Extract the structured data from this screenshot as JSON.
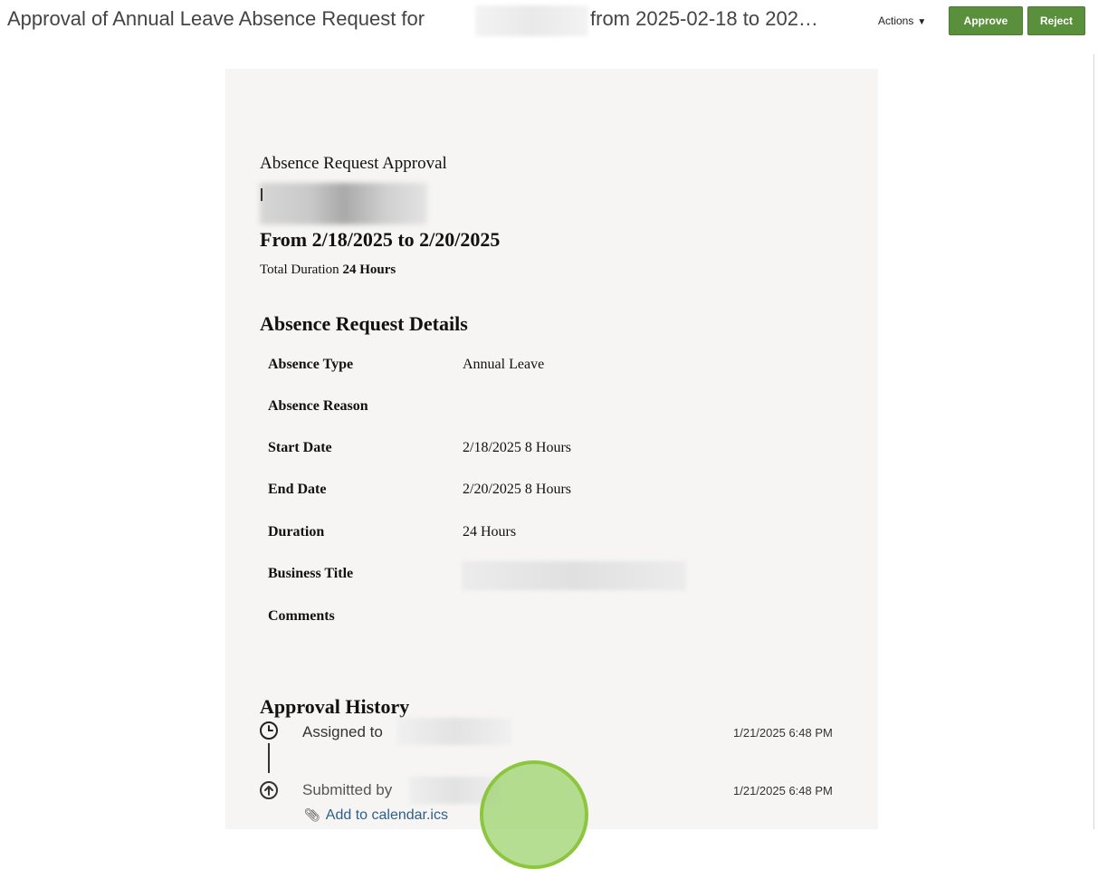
{
  "header": {
    "title_prefix": "Approval of Annual Leave Absence Request for",
    "title_suffix": "from 2025-02-18 to 202…",
    "actions_label": "Actions",
    "approve_label": "Approve",
    "reject_label": "Reject",
    "button_color": "#5a8f3c"
  },
  "card": {
    "heading": "Absence Request Approval",
    "date_range": "From 2/18/2025 to 2/20/2025",
    "total_label": "Total Duration",
    "total_value": "24 Hours"
  },
  "details": {
    "heading": "Absence Request Details",
    "rows": [
      {
        "label": "Absence Type",
        "value": "Annual Leave"
      },
      {
        "label": "Absence Reason",
        "value": ""
      },
      {
        "label": "Start Date",
        "value": "2/18/2025 8 Hours"
      },
      {
        "label": "End Date",
        "value": "2/20/2025 8 Hours"
      },
      {
        "label": "Duration",
        "value": "24 Hours"
      },
      {
        "label": "Business Title",
        "value": ""
      },
      {
        "label": "Comments",
        "value": ""
      }
    ]
  },
  "history": {
    "heading": "Approval History",
    "entries": [
      {
        "icon": "clock-icon",
        "text": "Assigned to",
        "date": "1/21/2025 6:48 PM"
      },
      {
        "icon": "arrow-up-circle-icon",
        "text": "Submitted by",
        "date": "1/21/2025 6:48 PM"
      }
    ],
    "attachment_link": "Add to calendar.ics"
  }
}
